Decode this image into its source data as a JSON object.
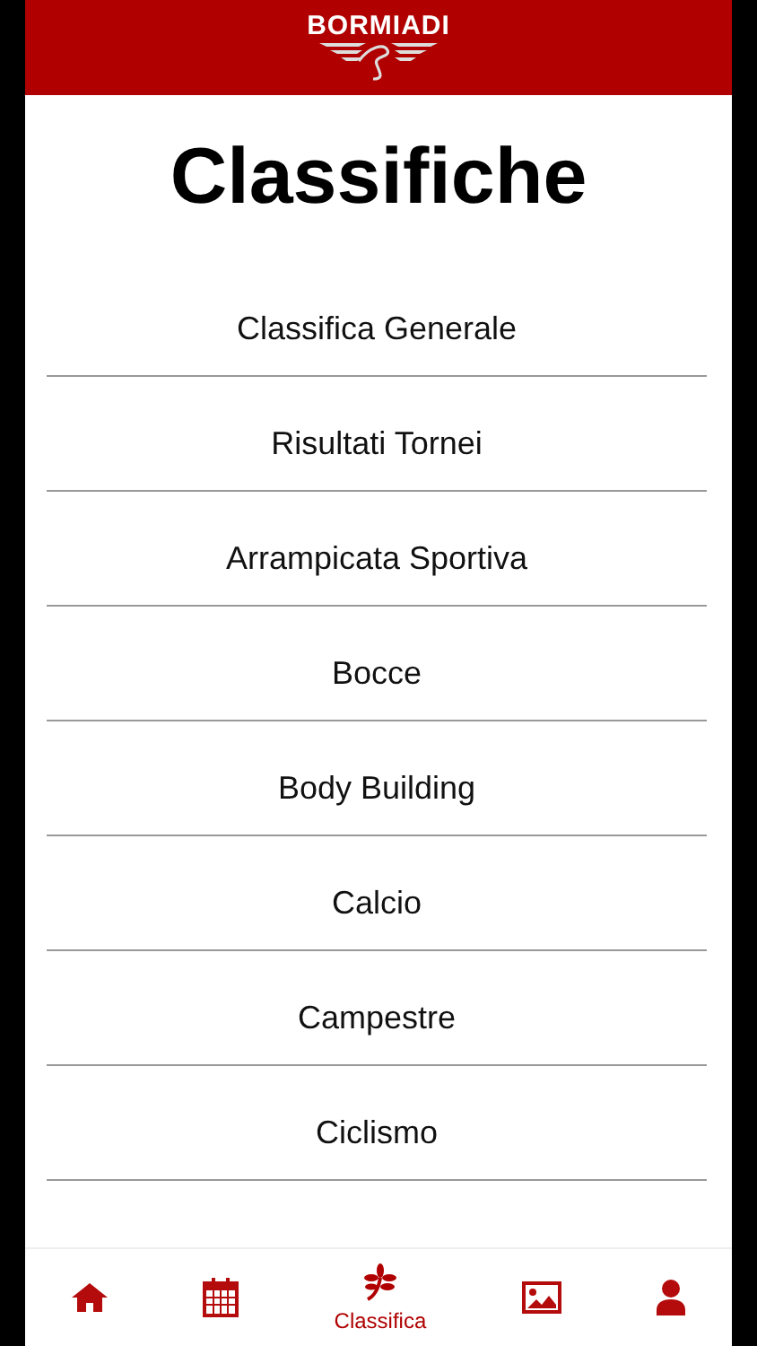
{
  "header": {
    "logo_text": "BORMIADI"
  },
  "title": "Classifiche",
  "items": [
    {
      "label": "Classifica Generale"
    },
    {
      "label": "Risultati Tornei"
    },
    {
      "label": "Arrampicata Sportiva"
    },
    {
      "label": "Bocce"
    },
    {
      "label": "Body Building"
    },
    {
      "label": "Calcio"
    },
    {
      "label": "Campestre"
    },
    {
      "label": "Ciclismo"
    }
  ],
  "tab_bar": [
    {
      "kind": "home",
      "selected": false
    },
    {
      "kind": "calendar",
      "selected": false
    },
    {
      "kind": "leaf",
      "selected": true,
      "label": "Classifica"
    },
    {
      "kind": "image",
      "selected": false
    },
    {
      "kind": "user",
      "selected": false
    }
  ]
}
